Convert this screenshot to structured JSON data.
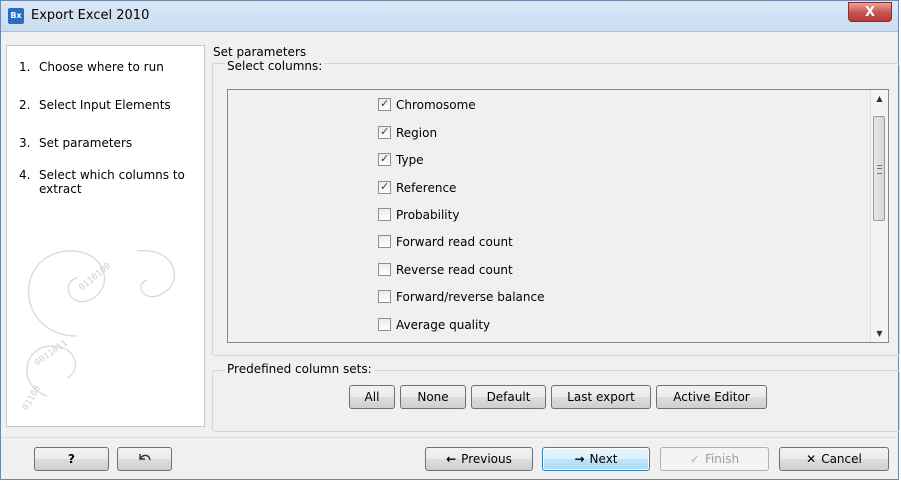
{
  "window": {
    "title": "Export Excel 2010",
    "app_icon": "Bx",
    "close_glyph": "X"
  },
  "sidebar": {
    "steps": [
      {
        "num": "1.",
        "label": "Choose where to run"
      },
      {
        "num": "2.",
        "label": "Select Input Elements"
      },
      {
        "num": "3.",
        "label": "Set parameters"
      },
      {
        "num": "4.",
        "label": "Select which columns to extract"
      }
    ]
  },
  "main": {
    "section_title": "Set parameters",
    "columns_group_label": "Select columns:",
    "columns": [
      {
        "label": "Chromosome",
        "checked": true
      },
      {
        "label": "Region",
        "checked": true
      },
      {
        "label": "Type",
        "checked": true
      },
      {
        "label": "Reference",
        "checked": true
      },
      {
        "label": "Probability",
        "checked": false
      },
      {
        "label": "Forward read count",
        "checked": false
      },
      {
        "label": "Reverse read count",
        "checked": false
      },
      {
        "label": "Forward/reverse balance",
        "checked": false
      },
      {
        "label": "Average quality",
        "checked": false
      }
    ],
    "predefined_label": "Predefined column sets:",
    "predefined_buttons": [
      "All",
      "None",
      "Default",
      "Last export",
      "Active Editor"
    ]
  },
  "footer": {
    "help_label": "?",
    "reset_icon": "undo-icon",
    "previous_label": "Previous",
    "next_label": "Next",
    "finish_label": "Finish",
    "cancel_label": "Cancel"
  }
}
